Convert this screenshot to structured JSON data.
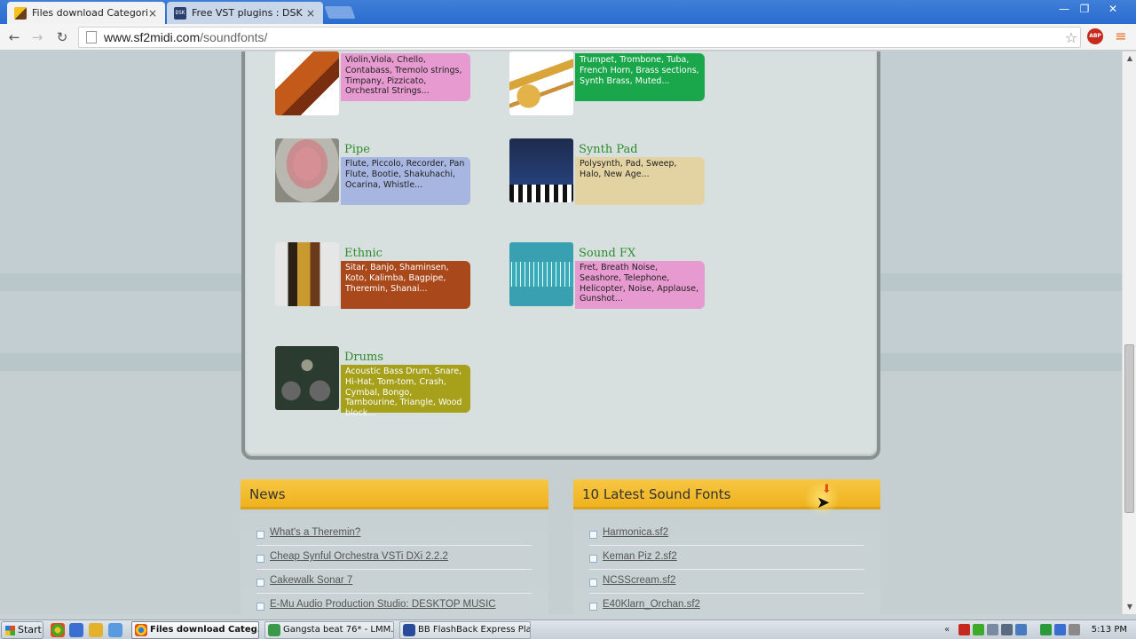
{
  "browser": {
    "tabs": [
      {
        "label": "Files download Categories",
        "close": "×"
      },
      {
        "label": "Free VST plugins : DSK Music",
        "close": "×",
        "favicon_text": "DSK"
      }
    ],
    "window_controls": {
      "minimize": "—",
      "maximize": "❐",
      "close": "✕"
    },
    "url": {
      "host": "www.sf2midi.com",
      "path": "/soundfonts/"
    },
    "abp_label": "ABP"
  },
  "categories": [
    {
      "id": "strings",
      "name": "",
      "desc": "Violin,Viola, Chello, Contabass, Tremolo strings, Timpany, Pizzicato, Orchestral Strings...",
      "color": "#e79ad0"
    },
    {
      "id": "brass",
      "name": "",
      "desc": "Trumpet, Trombone, Tuba, French Horn, Brass sections, Synth Brass, Muted...",
      "color": "#1aa64a"
    },
    {
      "id": "pipe",
      "name": "Pipe",
      "desc": "Flute, Piccolo, Recorder, Pan Flute, Bootie, Shakuhachi, Ocarina, Whistle...",
      "color": "#a7b6e0"
    },
    {
      "id": "synth",
      "name": "Synth Pad",
      "desc": "Polysynth, Pad, Sweep, Halo, New Age...",
      "color": "#e3d3a2"
    },
    {
      "id": "ethnic",
      "name": "Ethnic",
      "desc": "Sitar, Banjo, Shaminsen, Koto, Kalimba, Bagpipe, Theremin, Shanai...",
      "color": "#a9481a"
    },
    {
      "id": "fx",
      "name": "Sound FX",
      "desc": "Fret, Breath Noise, Seashore, Telephone, Helicopter, Noise, Applause, Gunshot...",
      "color": "#e79ad0"
    },
    {
      "id": "drums",
      "name": "Drums",
      "desc": "Acoustic Bass Drum, Snare, Hi-Hat, Tom-tom, Crash, Cymbal, Bongo, Tambourine, Triangle, Wood block...",
      "color": "#a6a01a"
    }
  ],
  "news": {
    "title": "News",
    "items": [
      "What's a Theremin?",
      "Cheap Synful Orchestra VSTi DXi 2.2.2",
      "Cakewalk Sonar 7",
      "E-Mu Audio Production Studio: DESKTOP MUSIC"
    ]
  },
  "latest": {
    "title": "10 Latest Sound Fonts",
    "items": [
      "Harmonica.sf2",
      "Keman Piz 2.sf2",
      "NCSScream.sf2",
      "E40Klarn_Orchan.sf2"
    ]
  },
  "taskbar": {
    "start": "Start",
    "tasks": [
      "Files download Categ...",
      "Gangsta beat 76* - LMM...",
      "BB FlashBack Express Pla..."
    ],
    "clock": "5:13 PM"
  }
}
